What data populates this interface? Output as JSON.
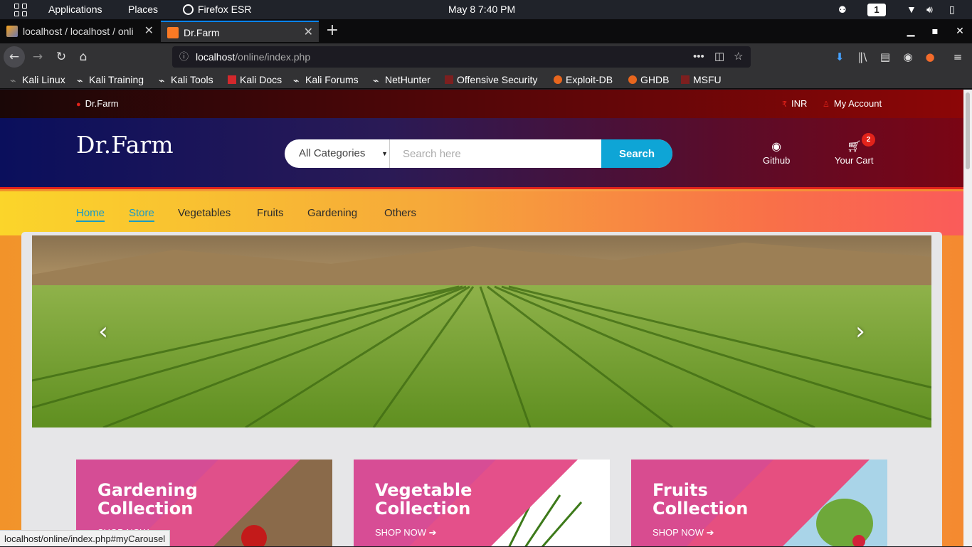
{
  "desktop": {
    "applications": "Applications",
    "places": "Places",
    "active_app": "Firefox ESR",
    "clock": "May 8   7:40 PM",
    "workspace": "1"
  },
  "browser": {
    "tabs": [
      {
        "title": "localhost / localhost / onli",
        "active": false
      },
      {
        "title": "Dr.Farm",
        "active": true
      }
    ],
    "url_host": "localhost",
    "url_path": "/online/index.php",
    "bookmarks": [
      "Kali Linux",
      "Kali Training",
      "Kali Tools",
      "Kali Docs",
      "Kali Forums",
      "NetHunter",
      "Offensive Security",
      "Exploit-DB",
      "GHDB",
      "MSFU"
    ],
    "status_url": "localhost/online/index.php#myCarousel"
  },
  "site": {
    "topbar": {
      "location": "Dr.Farm",
      "currency": "INR",
      "account": "My Account"
    },
    "logo": "Dr.Farm",
    "search": {
      "category": "All Categories",
      "placeholder": "Search here",
      "button": "Search"
    },
    "github": "Github",
    "cart": {
      "label": "Your Cart",
      "count": "2"
    },
    "nav": [
      "Home",
      "Store",
      "Vegetables",
      "Fruits",
      "Gardening",
      "Others"
    ],
    "collections": [
      {
        "line1": "Gardening",
        "line2": "Collection",
        "cta": "SHOP NOW"
      },
      {
        "line1": "Vegetable",
        "line2": "Collection",
        "cta": "SHOP NOW"
      },
      {
        "line1": "Fruits",
        "line2": "Collection",
        "cta": "SHOP NOW"
      }
    ]
  },
  "colors": {
    "accent_blue": "#0ea5d6",
    "brand_red": "#e2231a",
    "header_navy": "#0a0f5c"
  }
}
